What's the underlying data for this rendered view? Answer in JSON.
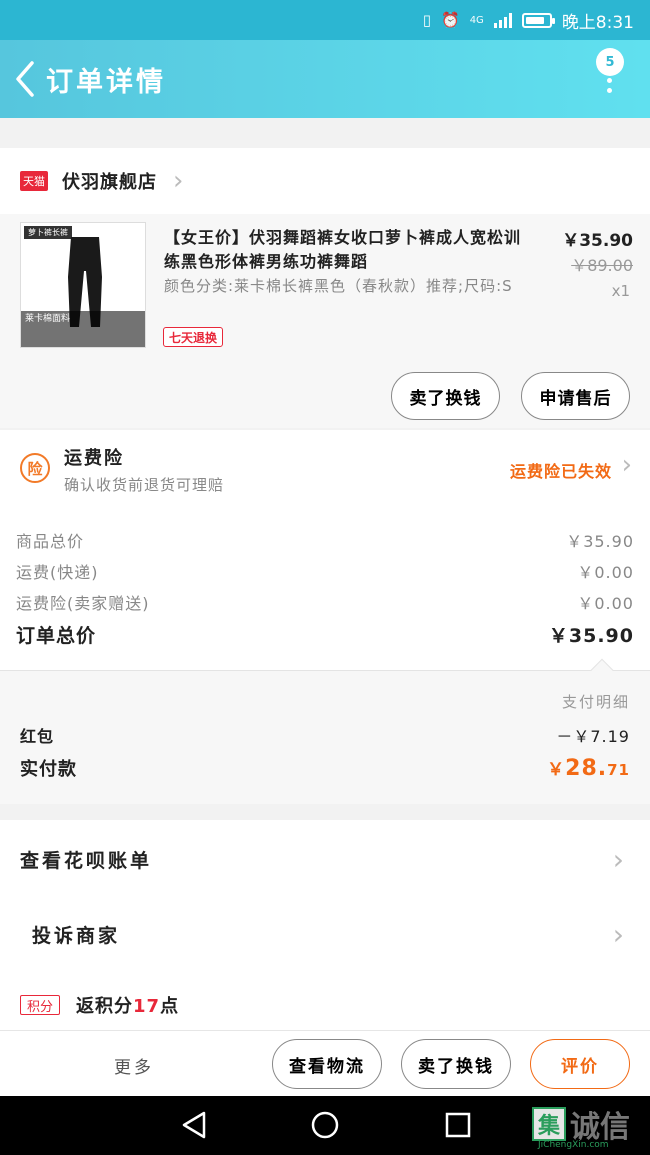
{
  "status_bar": {
    "time": "晚上8:31",
    "network": "4G"
  },
  "header": {
    "title": "订单详情",
    "badge": "5"
  },
  "shop": {
    "platform_tag": "天猫",
    "name": "伏羽旗舰店"
  },
  "product": {
    "thumb_label": "萝卜裤长裤",
    "thumb_caption": "莱卡棉面料",
    "title": "【女王价】伏羽舞蹈裤女收口萝卜裤成人宽松训练黑色形体裤男练功裤舞蹈",
    "sku": "颜色分类:莱卡棉长裤黑色（春秋款）推荐;尺码:S",
    "tag": "七天退换",
    "price": "￥35.90",
    "original_price": "￥89.00",
    "quantity": "x1",
    "buttons": {
      "sell_label": "卖了换钱",
      "aftersale_label": "申请售后"
    }
  },
  "insurance": {
    "icon": "险",
    "title": "运费险",
    "subtitle": "确认收货前退货可理赔",
    "status": "运费险已失效"
  },
  "summary": {
    "rows": [
      {
        "label": "商品总价",
        "value": "￥35.90"
      },
      {
        "label": "运费(快递)",
        "value": "￥0.00"
      },
      {
        "label": "运费险(卖家赠送)",
        "value": "￥0.00"
      }
    ],
    "total_label": "订单总价",
    "total_value": "￥35.90"
  },
  "payment": {
    "detail_label": "支付明细",
    "redpacket_label": "红包",
    "redpacket_value": "－￥7.19",
    "paid_label": "实付款",
    "paid_currency": "￥",
    "paid_int": "28.",
    "paid_dec": "71"
  },
  "links": {
    "huabei_label": "查看花呗账单",
    "complain_label": "投诉商家",
    "points_tag": "积分",
    "points_prefix": "返积分",
    "points_value": "17",
    "points_suffix": "点"
  },
  "bottom_bar": {
    "more_label": "更多",
    "logistics_label": "查看物流",
    "sell_label": "卖了换钱",
    "review_label": "评价"
  },
  "watermark": {
    "box": "集",
    "text": "诚信",
    "sub": "JiChengXin.com"
  },
  "colors": {
    "header_start": "#56c6dd",
    "header_end": "#60e0ef",
    "accent_orange": "#f26a15",
    "tmall_red": "#e8283a"
  }
}
